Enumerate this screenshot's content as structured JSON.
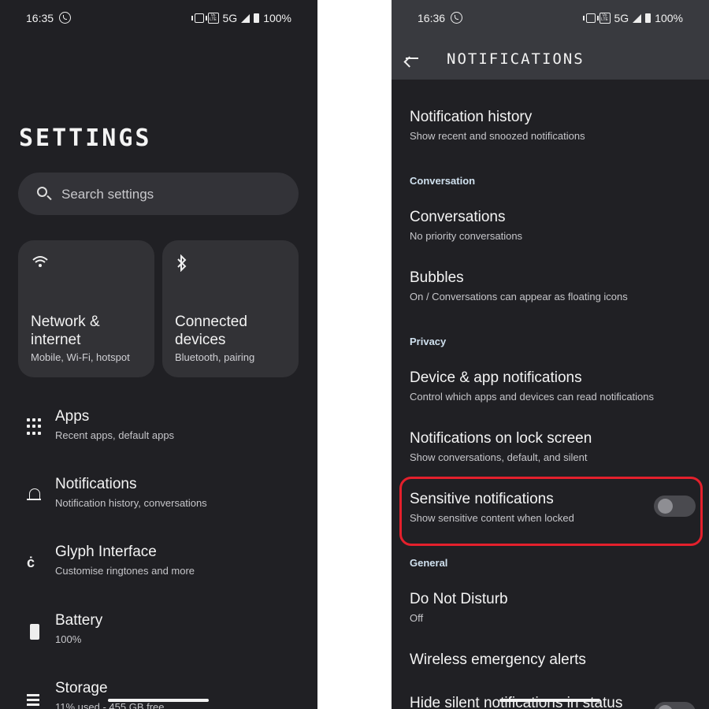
{
  "left_screen": {
    "status": {
      "time": "16:35",
      "network": "5G",
      "battery": "100%",
      "volte": "Vo LTE"
    },
    "title": "SETTINGS",
    "search": {
      "placeholder": "Search settings"
    },
    "tiles": [
      {
        "label": "Network & internet",
        "sub": "Mobile, Wi-Fi, hotspot",
        "icon": "wifi-icon"
      },
      {
        "label": "Connected devices",
        "sub": "Bluetooth, pairing",
        "icon": "bluetooth-icon"
      }
    ],
    "items": [
      {
        "title": "Apps",
        "sub": "Recent apps, default apps",
        "icon": "apps-grid-icon"
      },
      {
        "title": "Notifications",
        "sub": "Notification history, conversations",
        "icon": "bell-icon"
      },
      {
        "title": "Glyph Interface",
        "sub": "Customise ringtones and more",
        "icon": "glyph-icon"
      },
      {
        "title": "Battery",
        "sub": "100%",
        "icon": "battery-icon"
      },
      {
        "title": "Storage",
        "sub": "11% used - 455 GB free",
        "icon": "storage-icon"
      }
    ]
  },
  "right_screen": {
    "status": {
      "time": "16:36",
      "network": "5G",
      "battery": "100%",
      "volte": "Vo LTE"
    },
    "title": "NOTIFICATIONS",
    "rows": {
      "history": {
        "title": "Notification history",
        "sub": "Show recent and snoozed notifications"
      },
      "conversations": {
        "title": "Conversations",
        "sub": "No priority conversations"
      },
      "bubbles": {
        "title": "Bubbles",
        "sub": "On / Conversations can appear as floating icons"
      },
      "device_app": {
        "title": "Device & app notifications",
        "sub": "Control which apps and devices can read notifications"
      },
      "lock_screen": {
        "title": "Notifications on lock screen",
        "sub": "Show conversations, default, and silent"
      },
      "sensitive": {
        "title": "Sensitive notifications",
        "sub": "Show sensitive content when locked",
        "enabled": false
      },
      "dnd": {
        "title": "Do Not Disturb",
        "sub": "Off"
      },
      "emergency": {
        "title": "Wireless emergency alerts"
      },
      "hide_silent": {
        "title": "Hide silent notifications in status",
        "enabled": false
      }
    },
    "sections": {
      "conversation": "Conversation",
      "privacy": "Privacy",
      "general": "General"
    }
  },
  "colors": {
    "background": "#202024",
    "appbar": "#393a3f",
    "highlight": "#e4202c",
    "section": "#cfe0ee"
  }
}
